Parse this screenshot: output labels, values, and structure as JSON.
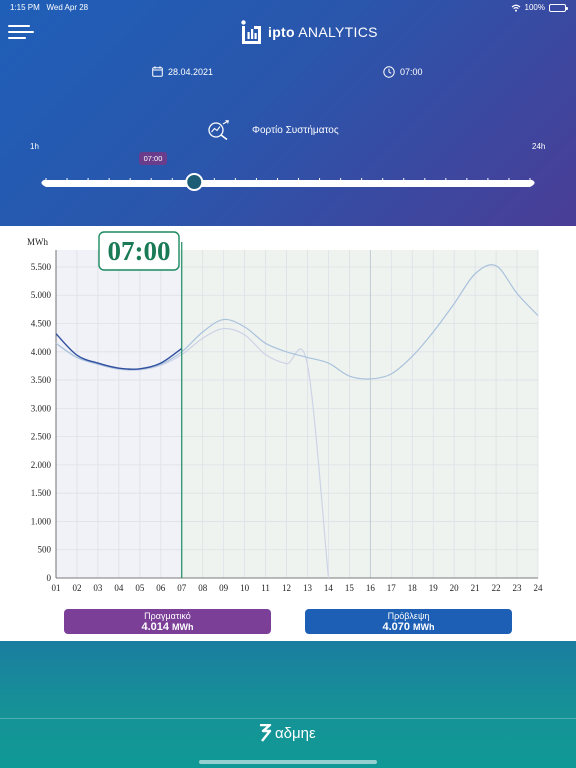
{
  "status_bar": {
    "time": "1:15 PM",
    "date": "Wed Apr 28",
    "battery": "100%"
  },
  "header": {
    "brand_bold": "ipto",
    "brand_rest": " ANALYTICS",
    "date": "28.04.2021",
    "time": "07:00",
    "metric_title": "Φορτίο Συστήματος"
  },
  "slider": {
    "min_label": "1h",
    "max_label": "24h",
    "selected_label": "07:00",
    "selected_hour": 7,
    "min_hour": 1,
    "max_hour": 24
  },
  "chart_data": {
    "type": "line",
    "ylabel": "MWh",
    "xlabel": "",
    "ylim": [
      0,
      5800
    ],
    "yticks": [
      0,
      500,
      1000,
      1500,
      2000,
      2500,
      3000,
      3500,
      4000,
      4500,
      5000,
      5500
    ],
    "ytick_labels": [
      "0",
      "500",
      "1.000",
      "1.500",
      "2.000",
      "2.500",
      "3.000",
      "3.500",
      "4.000",
      "4.500",
      "5.000",
      "5.500"
    ],
    "categories": [
      "01",
      "02",
      "03",
      "04",
      "05",
      "06",
      "07",
      "08",
      "09",
      "10",
      "11",
      "12",
      "13",
      "14",
      "15",
      "16",
      "17",
      "18",
      "19",
      "20",
      "21",
      "22",
      "23",
      "24"
    ],
    "x": [
      1,
      2,
      3,
      4,
      5,
      6,
      7,
      8,
      9,
      10,
      11,
      12,
      13,
      14,
      15,
      16,
      17,
      18,
      19,
      20,
      21,
      22,
      23,
      24
    ],
    "marker_label": "07:00",
    "marker_x": 7,
    "series": [
      {
        "name": "Πραγματικό",
        "color": "#2f4fa0",
        "values": [
          4320,
          3940,
          3800,
          3710,
          3700,
          3800,
          4060,
          null,
          null,
          null,
          null,
          null,
          null,
          null,
          null,
          null,
          null,
          null,
          null,
          null,
          null,
          null,
          null,
          null
        ]
      },
      {
        "name": "Πρόβλεψη",
        "color": "#a9c2dc",
        "values": [
          4150,
          3900,
          3780,
          3700,
          3690,
          3780,
          4000,
          4350,
          4570,
          4440,
          4150,
          4000,
          3900,
          3800,
          3570,
          3520,
          3610,
          3920,
          4350,
          4850,
          5380,
          5520,
          5030,
          4640
        ]
      },
      {
        "name": "",
        "color": "#cdd3e6",
        "values": [
          4150,
          3900,
          3780,
          3690,
          3680,
          3760,
          3950,
          4240,
          4410,
          4300,
          3950,
          3790,
          3770,
          0,
          null,
          null,
          null,
          null,
          null,
          null,
          null,
          null,
          null,
          null
        ]
      }
    ]
  },
  "summary": {
    "actual_label": "Πραγματικό",
    "actual_value": "4.014",
    "forecast_label": "Πρόβλεψη",
    "forecast_value": "4.070",
    "unit": "MWh"
  },
  "footer": {
    "logo_text": "αδμηε"
  },
  "colors": {
    "header_start": "#1f5fb8",
    "header_end": "#4a3d96",
    "actual": "#7b3f97",
    "forecast": "#1d5fb4",
    "marker": "#1a8a5f",
    "footer": "#169297"
  },
  "icons": {
    "menu": "hamburger-icon",
    "calendar": "calendar-icon",
    "clock": "clock-icon",
    "metric": "trend-search-icon"
  }
}
